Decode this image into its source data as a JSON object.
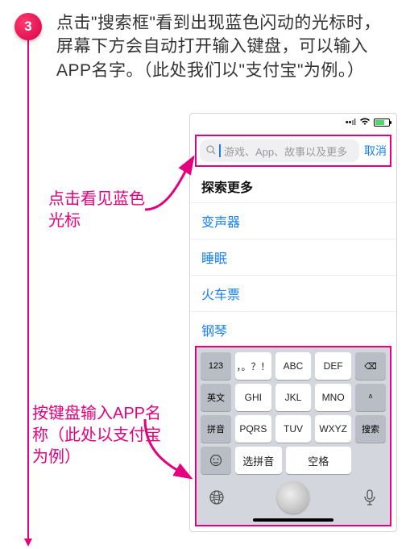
{
  "step_number": "3",
  "instruction": "点击\"搜索框\"看到出现蓝色闪动的光标时，屏幕下方会自动打开输入键盘，可以输入APP名字。（此处我们以\"支付宝\"为例。）",
  "callout1": "点击看见蓝色光标",
  "callout2": "按键盘输入APP名称（此处以支付宝为例）",
  "phone": {
    "search_placeholder": "游戏、App、故事以及更多",
    "cancel": "取消",
    "suggestions_title": "探索更多",
    "suggestions": [
      "变声器",
      "睡眠",
      "火车票",
      "钢琴"
    ],
    "keyboard": {
      "row1": {
        "k1": "123",
        "k2": "，。？！",
        "k3": "ABC",
        "k4": "DEF",
        "del": "⌫"
      },
      "row2": {
        "k1": "英文",
        "k2": "GHI",
        "k3": "JKL",
        "k4": "MNO",
        "up": "ᐞ"
      },
      "row3": {
        "k1": "拼音",
        "k2": "PQRS",
        "k3": "TUV",
        "k4": "WXYZ",
        "search": "搜索"
      },
      "row4": {
        "k1": "选拼音",
        "k2": "空格"
      },
      "globe": "⌨",
      "mic": "🎤"
    }
  }
}
